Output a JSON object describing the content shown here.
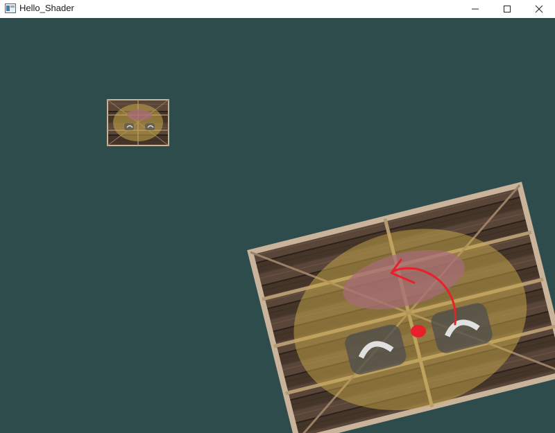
{
  "window": {
    "title": "Hello_Shader",
    "icon": "app-window-icon",
    "controls": [
      "minimize-icon",
      "maximize-icon",
      "close-icon"
    ]
  },
  "viewport": {
    "background_color": "#2f4c4c",
    "objects": [
      {
        "name": "small-textured-quad",
        "texture": "wooden-crate-with-face-overlay"
      },
      {
        "name": "large-rotated-textured-quad",
        "texture": "wooden-crate-with-face-overlay"
      }
    ],
    "annotation": {
      "type": "red-rotation-arrow",
      "color": "#e8202c"
    }
  },
  "colors": {
    "wood_dark": "#3f3128",
    "wood_plank": "#5a4638",
    "frame": "#c9b39b",
    "face_yellow": "#c9a94a",
    "face_pink": "#a76b7a",
    "annotation_red": "#e8202c"
  }
}
